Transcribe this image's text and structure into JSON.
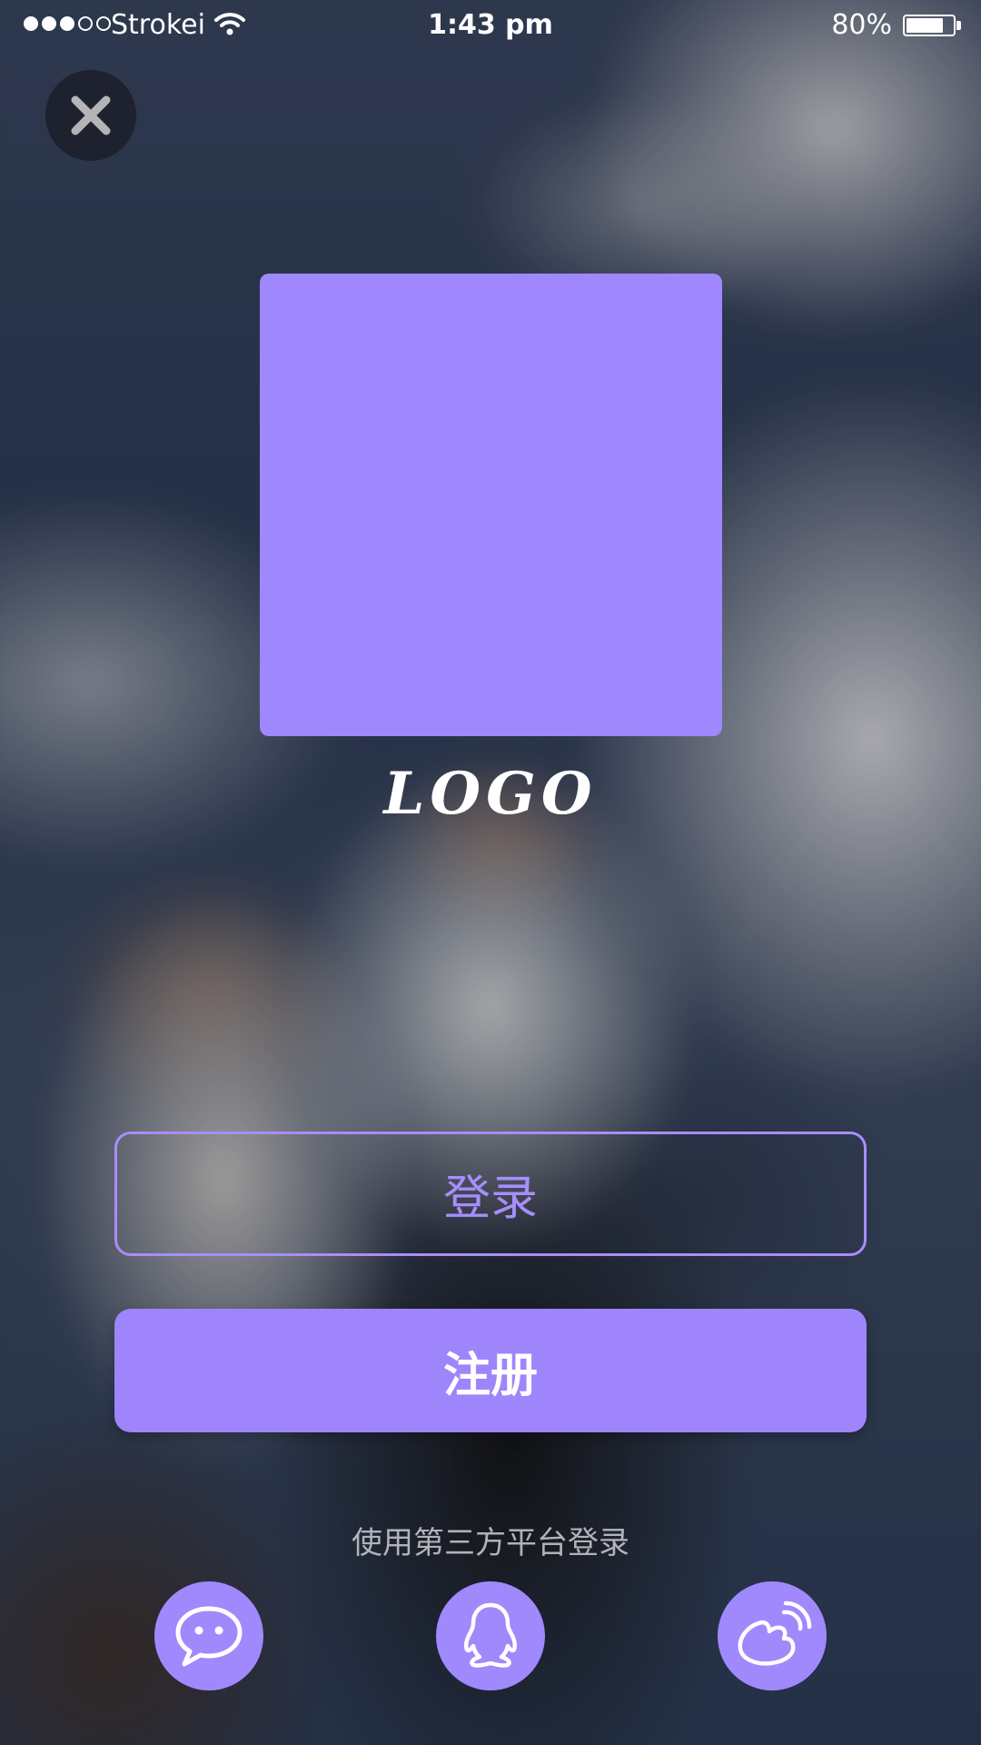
{
  "status_bar": {
    "carrier": "Strokei",
    "time": "1:43 pm",
    "battery": "80%",
    "battery_level": 0.8,
    "signal_bars_filled": 3,
    "signal_bars_total": 5
  },
  "close_button": {
    "icon": "close-icon"
  },
  "logo": {
    "text": "LOGO",
    "color": "#9f87fe"
  },
  "actions": {
    "login_label": "登录",
    "register_label": "注册"
  },
  "third_party": {
    "label": "使用第三方平台登录",
    "platforms": [
      {
        "name": "wechat",
        "icon": "wechat-icon"
      },
      {
        "name": "qq",
        "icon": "qq-icon"
      },
      {
        "name": "weibo",
        "icon": "weibo-icon"
      }
    ]
  },
  "colors": {
    "accent": "#9e85fc",
    "accent_border": "#a88dfc"
  }
}
